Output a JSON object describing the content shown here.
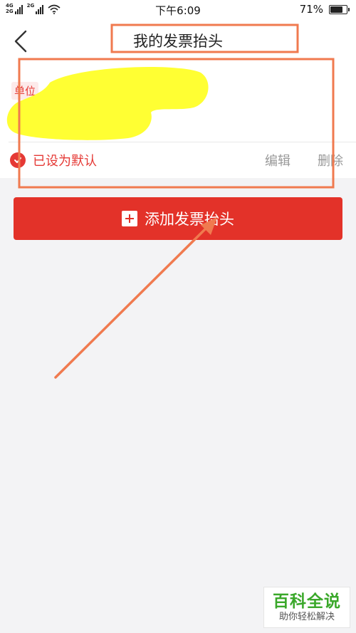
{
  "status_bar": {
    "sim1_label": "4G",
    "sim1_sub": "2G",
    "sim2_label": "2G",
    "time": "下午6:09",
    "battery_percent": "71%",
    "battery_level": 0.71
  },
  "navbar": {
    "title": "我的发票抬头",
    "back_icon": "chevron-left-icon"
  },
  "invoice_card": {
    "type_tag": "单位",
    "default_label": "已设为默认",
    "edit_label": "编辑",
    "delete_label": "删除"
  },
  "add_button": {
    "label": "添加发票抬头",
    "icon": "plus-square-icon"
  },
  "watermark": {
    "title": "百科全说",
    "subtitle": "助你轻松解决"
  },
  "colors": {
    "accent": "#e33229",
    "annotation": "#f07a4f",
    "redaction": "#ffff33",
    "watermark_green": "#3aa82a"
  }
}
